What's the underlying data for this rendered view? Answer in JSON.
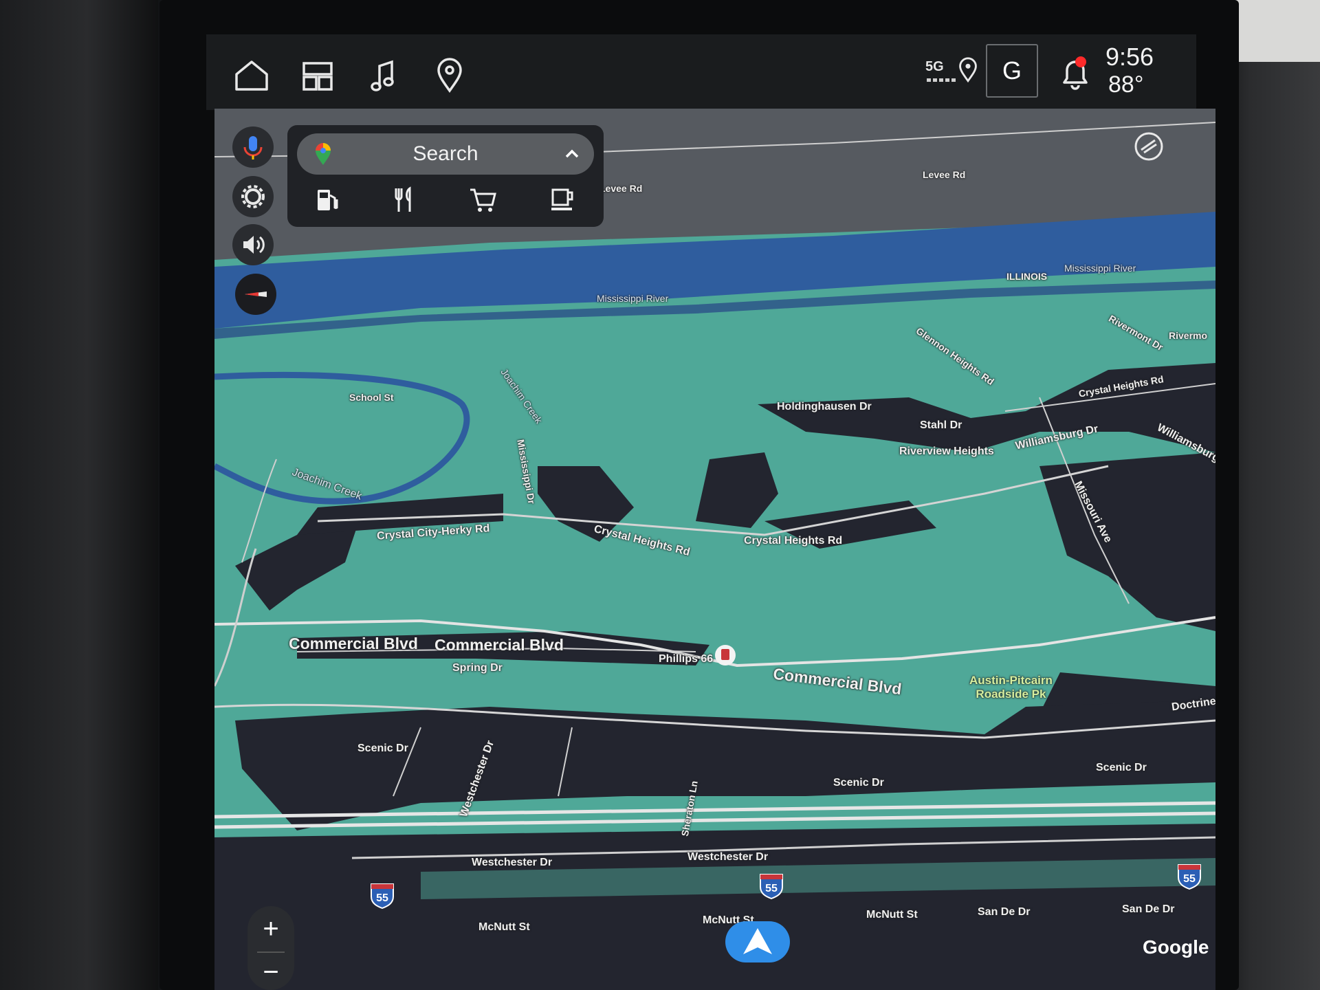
{
  "colors": {
    "land": "#4fa898",
    "urban": "#23252f",
    "river": "#2f5d9e",
    "road": "#e0e0e0",
    "nav": "#2f8ee8",
    "alert": "#ff2a2a"
  },
  "status_bar": {
    "network": "5G",
    "profile_initial": "G",
    "time": "9:56",
    "temperature": "88°",
    "icons": [
      "home-icon",
      "app-grid-icon",
      "music-icon",
      "location-pin-icon",
      "gps-icon",
      "bell-icon"
    ]
  },
  "search": {
    "label": "Search",
    "categories": [
      "gas-station-icon",
      "restaurant-icon",
      "shopping-cart-icon",
      "coffee-icon"
    ]
  },
  "rail": {
    "buttons": [
      "microphone-icon",
      "settings-icon",
      "volume-icon",
      "compass-icon"
    ]
  },
  "map": {
    "labels": {
      "levee_rd_1": "Levee Rd",
      "levee_rd_2": "Levee Rd",
      "mississippi_river_1": "Mississippi River",
      "mississippi_river_2": "Mississippi River",
      "illinois": "ILLINOIS",
      "rivermont_dr": "Rivermont Dr",
      "rivermo": "Rivermo",
      "glennon_heights_rd": "Glennon Heights Rd",
      "crystal_heights_rd_ne": "Crystal Heights Rd",
      "holdinghausen_dr": "Holdinghausen Dr",
      "stahl_dr": "Stahl Dr",
      "riverview_heights": "Riverview Heights",
      "williamsburg_dr_1": "Williamsburg Dr",
      "williamsburg_dr_2": "Williamsburg",
      "missouri_ave": "Missouri Ave",
      "school_st": "School St",
      "joachim_creek_1": "Joachim Creek",
      "joachim_creek_2": "Joachim Creek",
      "mississippi_dr": "Mississippi Dr",
      "crystal_city_herky_rd": "Crystal City-Herky Rd",
      "crystal_heights_rd_1": "Crystal Heights Rd",
      "crystal_heights_rd_2": "Crystal Heights Rd",
      "commercial_blvd_1": "Commercial Blvd",
      "commercial_blvd_2": "Commercial Blvd",
      "commercial_blvd_3": "Commercial Blvd",
      "spring_dr": "Spring Dr",
      "phillips_66": "Phillips 66",
      "austin_pitcairn": "Austin-Pitcairn",
      "roadside_pk": "Roadside Pk",
      "doctrine": "Doctrine",
      "scenic_dr_1": "Scenic Dr",
      "scenic_dr_2": "Scenic Dr",
      "scenic_dr_3": "Scenic Dr",
      "westchester_dr_1": "Westchester Dr",
      "westchester_dr_2": "Westchester Dr",
      "westchester_dr_3": "Westchester Dr",
      "sheraton_ln": "Sheraton Ln",
      "mcnutt_st_1": "McNutt St",
      "mcnutt_st_2": "McNutt St",
      "mcnutt_st_3": "McNutt St",
      "san_de_dr_1": "San De Dr",
      "san_de_dr_2": "San De Dr"
    },
    "interstate": "55",
    "attribution": "Google"
  },
  "zoom": {
    "in": "+",
    "out": "−"
  }
}
